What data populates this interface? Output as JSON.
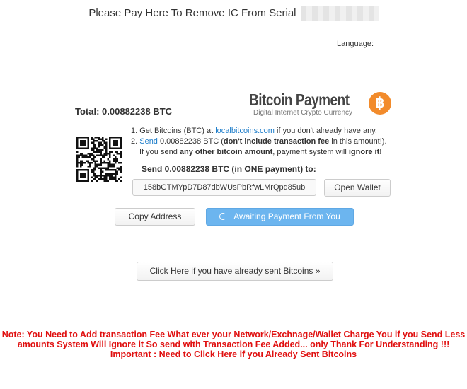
{
  "header": {
    "title": "Please Pay Here To Remove IC From Serial",
    "language_label": "Language:"
  },
  "logo": {
    "title": "Bitcoin Payment",
    "subtitle": "Digital Internet Crypto Currency",
    "coin_symbol": "฿",
    "coin_color": "#f28b2b"
  },
  "payment": {
    "total_label": "Total:",
    "total_value": "0.00882238 BTC",
    "step1_prefix": "1. Get Bitcoins (BTC) at ",
    "step1_link": "localbitcoins.com",
    "step1_suffix": " if you don't already have any.",
    "step2_prefix": "2. ",
    "step2_link": "Send",
    "step2_amount": " 0.00882238 BTC (",
    "step2_bold": "don't include transaction fee",
    "step2_suffix": " in this amount!).",
    "step3_prefix": "If you send ",
    "step3_bold1": "any other bitcoin amount",
    "step3_mid": ", payment system will ",
    "step3_bold2": "ignore it",
    "step3_suffix": "!",
    "send_line": "Send 0.00882238 BTC (in ONE payment) to:",
    "address": "158bGTMYpD7D87dbWUsPbRfwLMrQpd85ub",
    "link_color": "#1a7bc9"
  },
  "buttons": {
    "open_wallet": "Open Wallet",
    "copy_address": "Copy Address",
    "awaiting": "Awaiting Payment From You",
    "already_sent": "Click Here if you have already sent Bitcoins »"
  },
  "note": {
    "line1": "Note: You Need to Add transaction Fee What ever your Network/Exchnage/Wallet Charge You if you Send Less amounts System Will Ignore it So send with Transaction Fee Added... only Thank For Understanding !!!",
    "line2": "Important : Need to Click Here if you Already Sent Bitcoins",
    "color": "#e01010"
  }
}
